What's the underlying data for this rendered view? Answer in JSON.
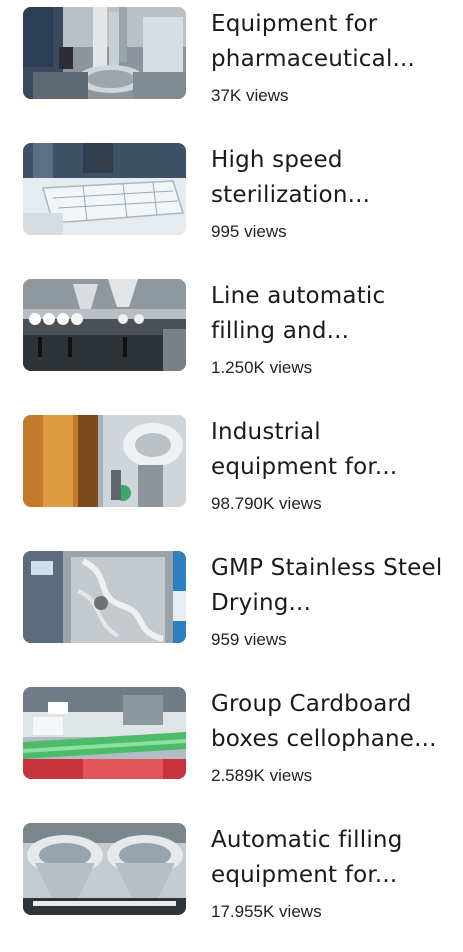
{
  "videos": [
    {
      "title": "Equipment for pharmaceutical...",
      "views": "37K views",
      "thumbnail": "pharmaceutical-equipment-thumbnail"
    },
    {
      "title": "High speed sterilization...",
      "views": "995 views",
      "thumbnail": "sterilization-machine-thumbnail"
    },
    {
      "title": "Line automatic filling and...",
      "views": "1.250K views",
      "thumbnail": "filling-line-thumbnail"
    },
    {
      "title": "Industrial equipment for...",
      "views": "98.790K views",
      "thumbnail": "industrial-equipment-thumbnail"
    },
    {
      "title": "GMP Stainless Steel Drying...",
      "views": "959 views",
      "thumbnail": "drying-oven-thumbnail"
    },
    {
      "title": "Group Cardboard boxes cellophane...",
      "views": "2.589K views",
      "thumbnail": "cellophane-wrapping-thumbnail"
    },
    {
      "title": "Automatic filling equipment for...",
      "views": "17.955K views",
      "thumbnail": "filling-hoppers-thumbnail"
    }
  ]
}
